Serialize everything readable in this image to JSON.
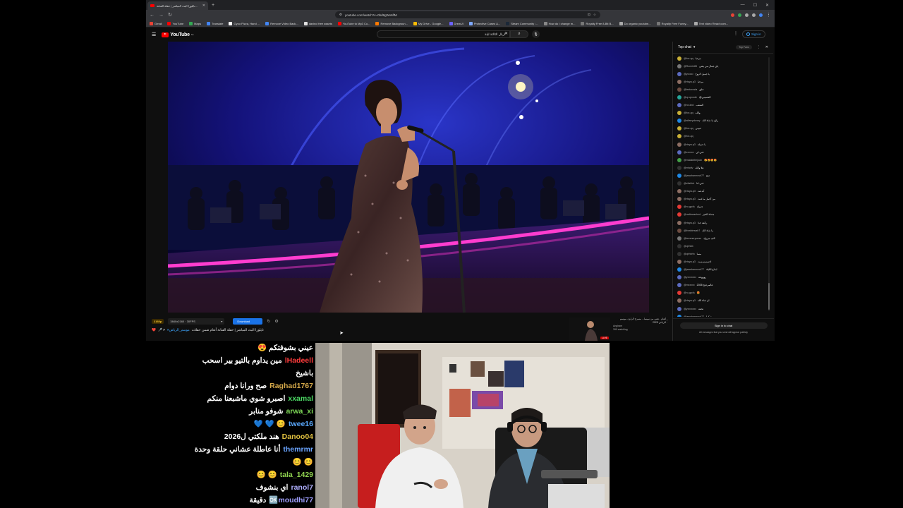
{
  "browser": {
    "tab_title": "تايلورا البث المباشر | حفلة الفنانة...",
    "url": "youtube.com/watch?v=0bd9gWx6lfM",
    "bookmarks": [
      "Gmail",
      "YouTube",
      "Maps",
      "Translate",
      "Oyoo Pizza, Hand ...",
      "Remove Video Back...",
      "davinci free assets",
      "YouTube to Mp3 Co...",
      "Remove Backgroun...",
      "My Drive - Google...",
      "DrewUI",
      "Protective Cases &...",
      "Steam Community :...",
      "How do I change m...",
      "Royalty Free 8-Bit B...",
      "Do organic youtube...",
      "Royalty Free Funny...",
      "Text video React com..."
    ],
    "colors": [
      "#ea4335",
      "#ff0000",
      "#34a853",
      "#4285f4",
      "#ffffff",
      "#4285f4",
      "#e0e0e0",
      "#ff0000",
      "#ff7a00",
      "#fbbc04",
      "#6c63ff",
      "#7ea8ff",
      "#1b2838",
      "#888888",
      "#777777",
      "#aaaaaa",
      "#777777",
      "#aaaaaa"
    ]
  },
  "youtube": {
    "logo": "YouTube",
    "logo_region": "SA",
    "search_value": "اريال الثالثة ليلة",
    "sign_in": "Sign in"
  },
  "below_video": {
    "quality_badge": "2160p",
    "quality": "3840x2160 · 30FPS",
    "download": "Download",
    "title_heart": "❤️",
    "title_text": "تايلورا البث المباشر | حفلة الفنانة أنغام ضمن حفلات",
    "title_link": "#موسم_الرياض",
    "title_tail": "🎤 #",
    "rec_title": "أنغام - تغني من سينما... مسرح الرابع - موسم الرياض 2025",
    "rec_channel": "Angham",
    "rec_watching": "390 watching",
    "live_badge": "LIVE"
  },
  "live_chat": {
    "header": "Top chat",
    "top_fans": "Top Fans",
    "sign_in_button": "Sign in to chat",
    "note": "All messages that you send will appear publicly",
    "messages": [
      {
        "author": "@fox-qq",
        "text": "مرحبا",
        "color": "#c9b037"
      },
      {
        "author": "@Ronnie85",
        "text": "ياي جمال من يغني",
        "color": "#777777"
      },
      {
        "author": "@yoooo",
        "text": "يا جميل الروح",
        "color": "#5c6bc0"
      },
      {
        "author": "@rtaya-q3",
        "text": "مرحبا",
        "color": "#8d6e63"
      },
      {
        "author": "@lestorosta",
        "text": "خلق",
        "color": "#6d4c41"
      },
      {
        "author": "@qr-qrcode",
        "text": "@الحسيني",
        "color": "#26a69a"
      },
      {
        "author": "@nx-kbd",
        "text": "الشعب",
        "color": "#5c6bc0"
      },
      {
        "author": "@fox-qq",
        "text": "والله",
        "color": "#c9b037"
      },
      {
        "author": "@alfarrydonny",
        "text": "رائع ما شاء الله",
        "color": "#1e88e5"
      },
      {
        "author": "@fox-qq",
        "text": "حبيبي",
        "color": "#c9b037"
      },
      {
        "author": "@fox-qq",
        "text": "",
        "color": "#c9b037"
      },
      {
        "author": "@rtaya-q3",
        "text": "يا جميلة",
        "color": "#8d6e63"
      },
      {
        "author": "@xxxxxx",
        "text": "غني لي",
        "color": "#5c6bc0"
      },
      {
        "author": "@malakbbhjoan",
        "text": "😍😍😍😍",
        "color": "#43a047"
      },
      {
        "author": "@mhdtv",
        "text": "هلا والله",
        "color": "#333333"
      },
      {
        "author": "@jawaharmnsh77",
        "text": "صح",
        "color": "#1e88e5"
      },
      {
        "author": "@ellahbb",
        "text": "غني لنا",
        "color": "#333333"
      },
      {
        "author": "@rtaya-q3",
        "text": "أبدعت",
        "color": "#8d6e63"
      },
      {
        "author": "@rtaya-q3",
        "text": "من أجمل ما غنت",
        "color": "#8d6e63"
      },
      {
        "author": "@ru-gp4s",
        "text": "جميلة",
        "color": "#e53935"
      },
      {
        "author": "@radiowashed",
        "text": "مساء الخير",
        "color": "#e53935"
      },
      {
        "author": "@rtaya-q3",
        "text": "رائعة جدا",
        "color": "#8d6e63"
      },
      {
        "author": "@ibrahimsab7",
        "text": "ما شاء الله",
        "color": "#6d4c41"
      },
      {
        "author": "@iemmeryouss",
        "text": "الف مبروك",
        "color": "#777777"
      },
      {
        "author": "@qhhbb",
        "text": "",
        "color": "#333333"
      },
      {
        "author": "@qhhhhh",
        "text": "مسا",
        "color": "#333333"
      },
      {
        "author": "@rtaya-q3",
        "text": "احسسسست",
        "color": "#8d6e63"
      },
      {
        "author": "@jawaharmnsh77",
        "text": "ابداع الليلة",
        "color": "#1e88e5"
      },
      {
        "author": "@yxxxxxxx",
        "text": "روووعة",
        "color": "#5c6bc0"
      },
      {
        "author": "@mxxxxx",
        "text": "عالمرجيح 2026",
        "color": "#5c6bc0"
      },
      {
        "author": "@ru-gp4s",
        "text": "😍",
        "color": "#e53935"
      },
      {
        "author": "@rtaya-q3",
        "text": "ان شاء الله",
        "color": "#8d6e63"
      },
      {
        "author": "@yxxxxxxx",
        "text": "تحفة",
        "color": "#5c6bc0"
      },
      {
        "author": "@jawaharmnsh77",
        "text": "شكرا",
        "color": "#1e88e5"
      },
      {
        "author": "@dhimoa12",
        "text": "قولوها",
        "color": "#333333"
      }
    ]
  },
  "stream_chat": [
    {
      "user": "",
      "text": "عيني بشوفتكم 😍",
      "color": "#ffffff"
    },
    {
      "user": "lHadeell",
      "text": "مين يداوم بالتيو بير اسحب",
      "cont": "باشيخ",
      "color": "#ff3b3b"
    },
    {
      "user": "Raghad1767",
      "text": "صح ورانا دوام",
      "color": "#d4a84a"
    },
    {
      "user": "xxamal",
      "text": "اصبرو شوي ماشبعنا منكم",
      "color": "#4cd964"
    },
    {
      "user": "arwa_xi",
      "text": "شوفو منابر",
      "color": "#7ed957"
    },
    {
      "user": "twee16",
      "text": "😊 💙 💙",
      "color": "#5aa9ff"
    },
    {
      "user": "Danoo04",
      "text": "هند ملكتي ل2026",
      "color": "#e0c040"
    },
    {
      "user": "themrmr",
      "text": "أنا عاطلة عشاني حلقة وحدة",
      "cont": "😊 😊",
      "color": "#6aa4ff"
    },
    {
      "user": "tala_1429",
      "text": "😊 😊",
      "color": "#8fd14f"
    },
    {
      "user": "ranol7",
      "text": "اي بنشوف",
      "color": "#b0b0ff"
    },
    {
      "user": "🆗moudhi77",
      "text": "دقيقة",
      "color": "#a0a0ff"
    }
  ]
}
